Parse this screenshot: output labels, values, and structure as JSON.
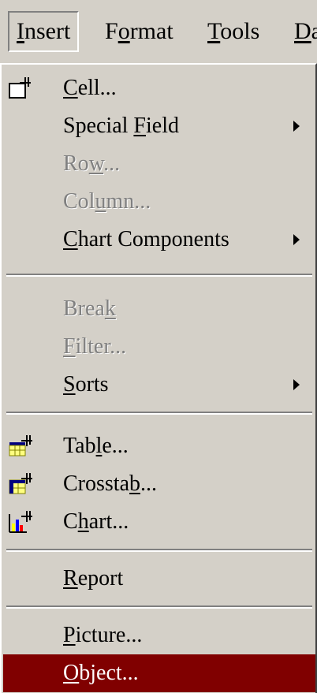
{
  "menubar": {
    "items": [
      {
        "label": "Insert",
        "accel": "I",
        "active": true
      },
      {
        "label": "Format",
        "accel": "o",
        "active": false
      },
      {
        "label": "Tools",
        "accel": "T",
        "active": false
      },
      {
        "label": "Da",
        "accel": "D",
        "active": false
      }
    ]
  },
  "menu": {
    "items": [
      {
        "label": "Cell...",
        "accel": "C",
        "icon": "cell-icon",
        "enabled": true
      },
      {
        "label": "Special Field",
        "accel": "F",
        "submenu": true,
        "enabled": true
      },
      {
        "label": "Row...",
        "accel": "w",
        "enabled": false
      },
      {
        "label": "Column...",
        "accel": "u",
        "enabled": false
      },
      {
        "label": "Chart Components",
        "accel": "C",
        "submenu": true,
        "enabled": true
      },
      {
        "label": "Break",
        "accel": "k",
        "enabled": false
      },
      {
        "label": "Filter...",
        "accel": "F",
        "enabled": false
      },
      {
        "label": "Sorts",
        "accel": "S",
        "submenu": true,
        "enabled": true
      },
      {
        "label": "Table...",
        "accel": "l",
        "icon": "table-icon",
        "enabled": true
      },
      {
        "label": "Crosstab...",
        "accel": "b",
        "icon": "crosstab-icon",
        "enabled": true
      },
      {
        "label": "Chart...",
        "accel": "h",
        "icon": "chart-icon",
        "enabled": true
      },
      {
        "label": "Report",
        "accel": "R",
        "enabled": true
      },
      {
        "label": "Picture...",
        "accel": "P",
        "enabled": true
      },
      {
        "label": "Object...",
        "accel": "O",
        "enabled": true,
        "selected": true
      }
    ]
  },
  "colors": {
    "face": "#d4d0c8",
    "highlight": "#800000",
    "disabled_text": "#808080"
  }
}
